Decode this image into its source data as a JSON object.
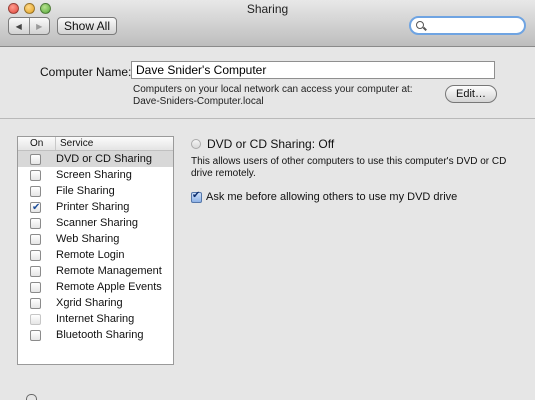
{
  "window": {
    "title": "Sharing"
  },
  "toolbar": {
    "back_glyph": "◀",
    "forward_glyph": "▶",
    "show_all_label": "Show All",
    "search_placeholder": ""
  },
  "computer_name": {
    "label": "Computer Name:",
    "value": "Dave Snider's Computer",
    "note": "Computers on your local network can access your computer at: Dave-Sniders-Computer.local",
    "edit_label": "Edit…"
  },
  "services": {
    "header_on": "On",
    "header_service": "Service",
    "items": [
      {
        "name": "DVD or CD Sharing",
        "checked": false,
        "selected": true
      },
      {
        "name": "Screen Sharing",
        "checked": false
      },
      {
        "name": "File Sharing",
        "checked": false
      },
      {
        "name": "Printer Sharing",
        "checked": true
      },
      {
        "name": "Scanner Sharing",
        "checked": false
      },
      {
        "name": "Web Sharing",
        "checked": false
      },
      {
        "name": "Remote Login",
        "checked": false
      },
      {
        "name": "Remote Management",
        "checked": false
      },
      {
        "name": "Remote Apple Events",
        "checked": false
      },
      {
        "name": "Xgrid Sharing",
        "checked": false
      },
      {
        "name": "Internet Sharing",
        "checked": false,
        "disabled": true
      },
      {
        "name": "Bluetooth Sharing",
        "checked": false
      }
    ]
  },
  "detail": {
    "status": "DVD or CD Sharing: Off",
    "description": "This allows users of other computers to use this computer's DVD or CD drive remotely.",
    "ask_label": "Ask me before allowing others to use my DVD drive",
    "ask_checked": true
  }
}
